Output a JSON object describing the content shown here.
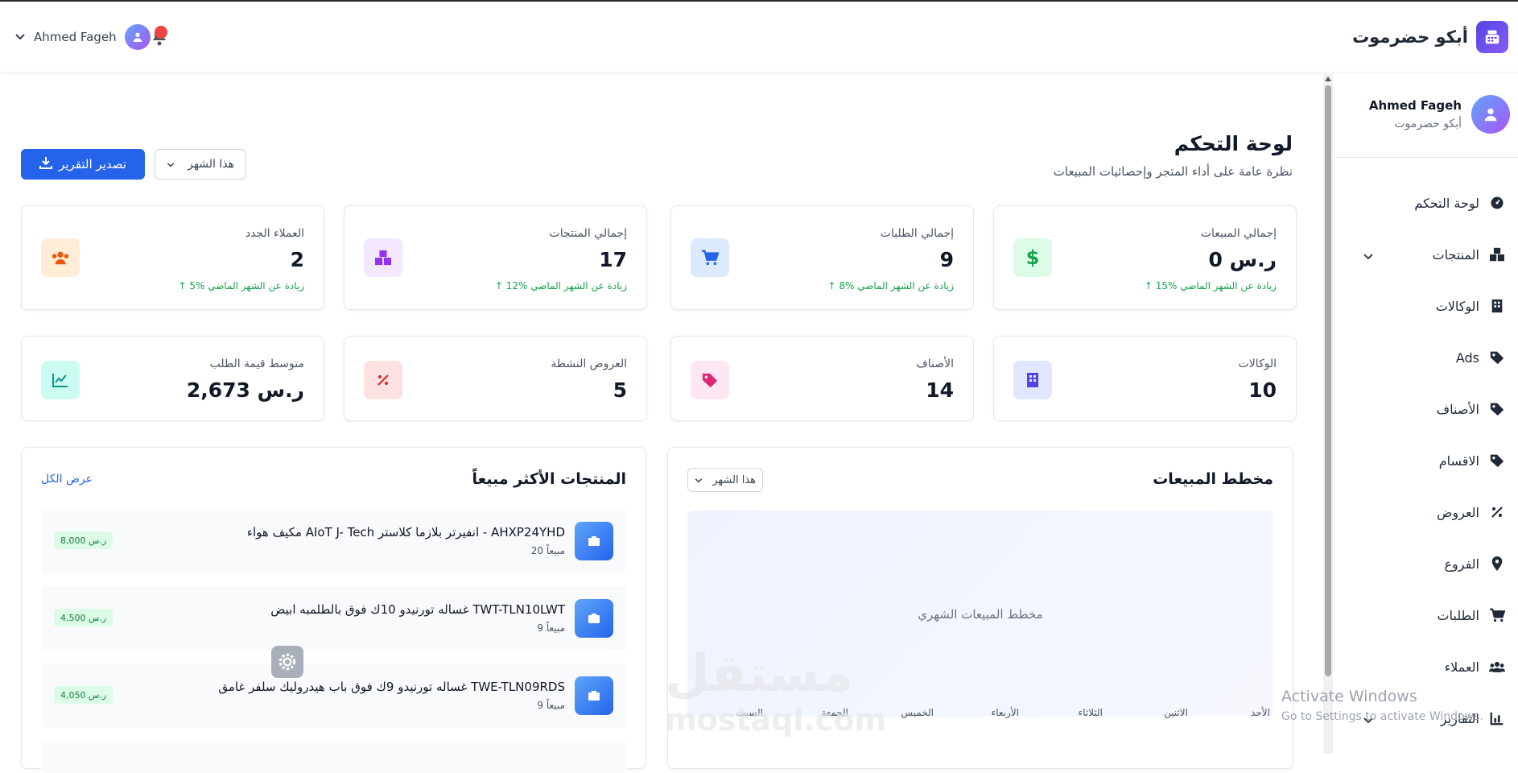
{
  "header": {
    "brand_name": "أبكو حضرموت",
    "user_name": "Ahmed Fageh"
  },
  "sidebar": {
    "profile_name": "Ahmed Fageh",
    "profile_store": "أبكو حضرموت",
    "items": [
      {
        "label": "لوحة التحكم",
        "icon": "dashboard-icon"
      },
      {
        "label": "المنتجات",
        "icon": "boxes-icon",
        "expandable": true
      },
      {
        "label": "الوكالات",
        "icon": "building-icon"
      },
      {
        "label": "Ads",
        "icon": "tag-icon"
      },
      {
        "label": "الأصناف",
        "icon": "tag-icon"
      },
      {
        "label": "الاقسام",
        "icon": "tag-icon"
      },
      {
        "label": "العروض",
        "icon": "percent-icon"
      },
      {
        "label": "الفروع",
        "icon": "location-pin-icon"
      },
      {
        "label": "الطلبات",
        "icon": "cart-icon"
      },
      {
        "label": "العملاء",
        "icon": "users-icon"
      },
      {
        "label": "التقارير",
        "icon": "chart-icon",
        "expandable": true
      }
    ]
  },
  "main": {
    "title": "لوحة التحكم",
    "subtitle": "نظرة عامة على أداء المتجر وإحصائيات المبيعات",
    "export_label": "تصدير التقرير",
    "period_label": "هذا الشهر"
  },
  "stats_row1": [
    {
      "title": "إجمالي المبيعات",
      "value": "0 ر.س",
      "trend": "15% زيادة عن الشهر الماضي",
      "icon": "dollar-icon",
      "bg": "#dcfce7",
      "fg": "#16a34a"
    },
    {
      "title": "إجمالي الطلبات",
      "value": "9",
      "trend": "8% زيادة عن الشهر الماضي",
      "icon": "cart-icon",
      "bg": "#dbeafe",
      "fg": "#2563eb"
    },
    {
      "title": "إجمالي المنتجات",
      "value": "17",
      "trend": "12% زيادة عن الشهر الماضي",
      "icon": "boxes-icon",
      "bg": "#f3e8ff",
      "fg": "#9333ea"
    },
    {
      "title": "العملاء الجدد",
      "value": "2",
      "trend": "5% زيادة عن الشهر الماضي",
      "icon": "users-icon",
      "bg": "#ffedd5",
      "fg": "#ea580c"
    }
  ],
  "stats_row2": [
    {
      "title": "الوكالات",
      "value": "10",
      "icon": "building-icon",
      "bg": "#e0e7ff",
      "fg": "#4f46e5"
    },
    {
      "title": "الأصناف",
      "value": "14",
      "icon": "tag-icon",
      "bg": "#fce7f3",
      "fg": "#db2777"
    },
    {
      "title": "العروض النشطة",
      "value": "5",
      "icon": "percent-icon",
      "bg": "#fee2e2",
      "fg": "#dc2626"
    },
    {
      "title": "متوسط قيمة الطلب",
      "value": "2,673 ر.س",
      "icon": "chart-line-icon",
      "bg": "#ccfbf1",
      "fg": "#0d9488"
    }
  ],
  "sales_chart": {
    "title": "مخطط المبيعات",
    "period": "هذا الشهر",
    "placeholder": "مخطط المبيعات الشهري",
    "days": [
      "الأحد",
      "الاثنين",
      "الثلاثاء",
      "الأربعاء",
      "الخميس",
      "الجمعة",
      "السبت"
    ]
  },
  "top_products": {
    "title": "المنتجات الأكثر مبيعاً",
    "view_all": "عرض الكل",
    "items": [
      {
        "name": "مكيف هواء AIoT J- Tech انفيرتر بلازما كلاستر - AHXP24YHD",
        "sold": "20 مبيعاً",
        "price": "8,000 ر.س"
      },
      {
        "name": "غساله تورنيدو 10ك فوق بالطلمبه ابيض TWT-TLN10LWT",
        "sold": "9 مبيعاً",
        "price": "4,500 ر.س"
      },
      {
        "name": "غساله تورنيدو 9ك فوق باب هيدروليك سلفر غامق TWE-TLN09RDS",
        "sold": "9 مبيعاً",
        "price": "4,050 ر.س"
      }
    ]
  },
  "watermark": {
    "ar": "مستقل",
    "en": "mostaql.com",
    "activate_title": "Activate Windows",
    "activate_sub": "Go to Settings to activate Windows."
  }
}
